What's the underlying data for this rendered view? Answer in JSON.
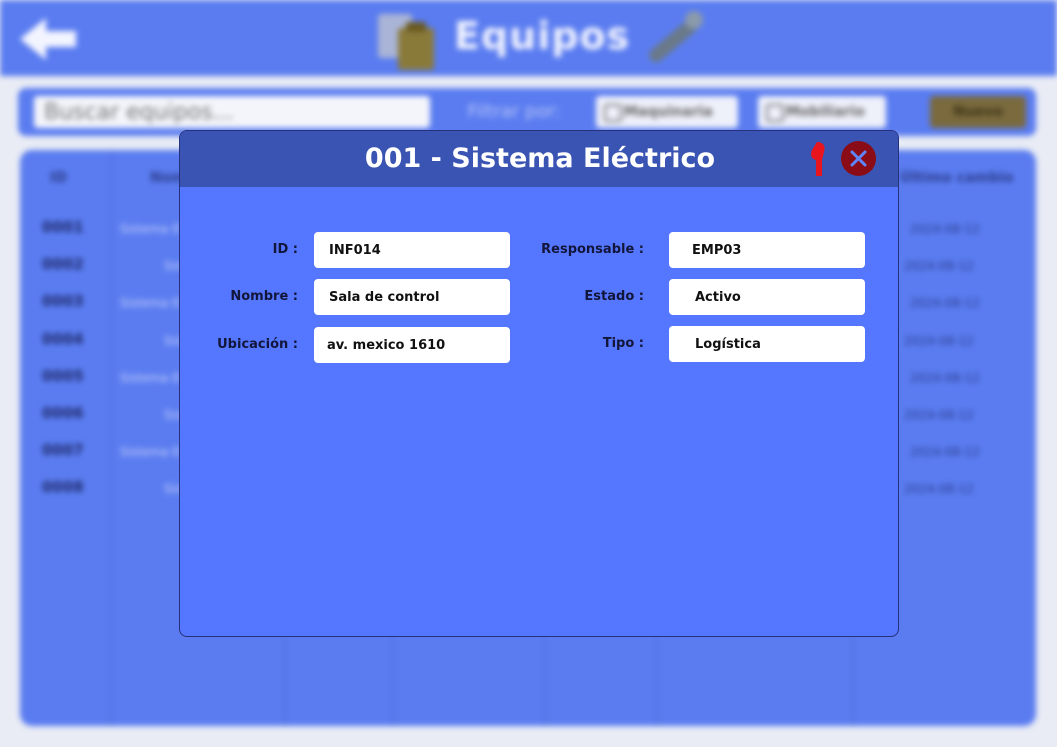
{
  "header": {
    "title": "Equipos",
    "back_icon": "arrow-left-icon"
  },
  "toolbar": {
    "search_placeholder": "Buscar equipos...",
    "filter_label": "Filtrar por:",
    "chip_1": "Maquinaria",
    "chip_2": "Mobiliario",
    "new_button": "Nuevo"
  },
  "table": {
    "headers": {
      "id": "ID",
      "name": "Nombre",
      "last": "Último cambio"
    },
    "rows": [
      {
        "id": "0001",
        "name": "Sistema Eléctrico",
        "date": "2024-08-12"
      },
      {
        "id": "0002",
        "name": "Sistema",
        "date": "2024-08-12"
      },
      {
        "id": "0003",
        "name": "Sistema Eléctrico",
        "date": "2024-08-12"
      },
      {
        "id": "0004",
        "name": "Sistema",
        "date": "2024-08-12"
      },
      {
        "id": "0005",
        "name": "Sistema Eléctrico",
        "date": "2024-08-12"
      },
      {
        "id": "0006",
        "name": "Sistema",
        "date": "2024-08-12"
      },
      {
        "id": "0007",
        "name": "Sistema Eléctrico",
        "date": "2024-08-12"
      },
      {
        "id": "0008",
        "name": "Sistema",
        "date": "2024-08-12"
      }
    ]
  },
  "modal": {
    "title": "001 - Sistema Eléctrico",
    "close_icon": "close-icon",
    "fields": {
      "id": {
        "label": "ID :",
        "value": "INF014"
      },
      "nombre": {
        "label": "Nombre :",
        "value": "Sala de control"
      },
      "ubicacion": {
        "label": "Ubicación :",
        "value": "av. mexico 1610"
      },
      "responsable": {
        "label": "Responsable :",
        "value": "EMP03"
      },
      "estado": {
        "label": "Estado :",
        "value": "Activo"
      },
      "tipo": {
        "label": "Tipo :",
        "value": "Logística"
      }
    }
  },
  "colors": {
    "accent": "#5577ff",
    "modal_header": "#3a54b3",
    "close_button": "#8a0c16",
    "marker": "#e8141e"
  }
}
